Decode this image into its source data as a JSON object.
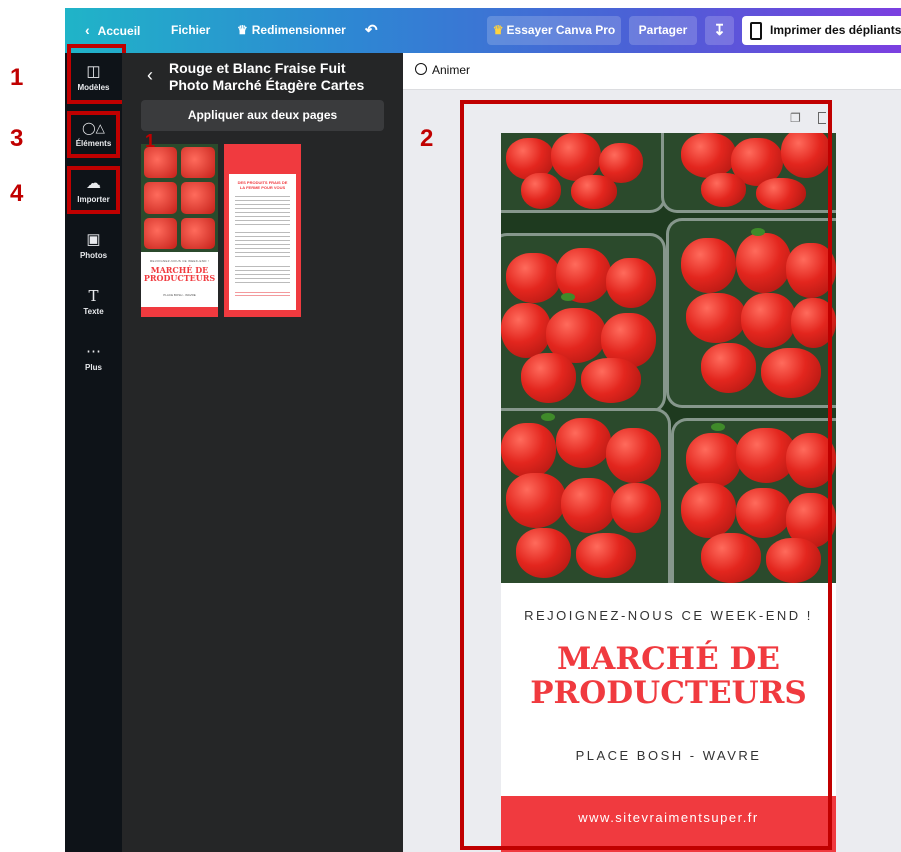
{
  "topbar": {
    "home": "Accueil",
    "file": "Fichier",
    "resize": "Redimensionner",
    "try_pro": "Essayer Canva Pro",
    "share": "Partager",
    "print": "Imprimer des dépliants"
  },
  "sidebar": {
    "items": [
      {
        "label": "Modèles",
        "icon": "layout-icon"
      },
      {
        "label": "Éléments",
        "icon": "shapes-icon"
      },
      {
        "label": "Importer",
        "icon": "upload-cloud-icon"
      },
      {
        "label": "Photos",
        "icon": "image-icon"
      },
      {
        "label": "Texte",
        "icon": "text-icon"
      },
      {
        "label": "Plus",
        "icon": "more-icon"
      }
    ]
  },
  "panel": {
    "title_line1": "Rouge et Blanc Fraise Fuit",
    "title_line2": "Photo Marché Étagère Cartes",
    "apply_button": "Appliquer aux deux pages"
  },
  "canvas": {
    "animate": "Animer"
  },
  "design": {
    "tagline": "REJOIGNEZ-NOUS CE WEEK-END !",
    "heading_line1": "MARCHÉ DE",
    "heading_line2": "PRODUCTEURS",
    "location": "PLACE BOSH - WAVRE",
    "website": "www.sitevraimentsuper.fr"
  },
  "thumb1": {
    "tagline": "REJOIGNEZ-NOUS CE WEEK-END !",
    "heading_line1": "MARCHÉ DE",
    "heading_line2": "PRODUCTEURS",
    "location": "PLACE BOSH - WAVRE"
  },
  "thumb2": {
    "heading_line1": "DES PRODUITS FRAIS DE",
    "heading_line2": "LA FERME POUR VOUS"
  },
  "annotations": {
    "n1": "1",
    "n2": "2",
    "n3": "3",
    "n4": "4",
    "n1_small": "1"
  },
  "colors": {
    "brand_red": "#f03a3f",
    "annotation_red": "#c00000",
    "sidebar_bg": "#0e1318",
    "panel_bg": "#252627"
  }
}
